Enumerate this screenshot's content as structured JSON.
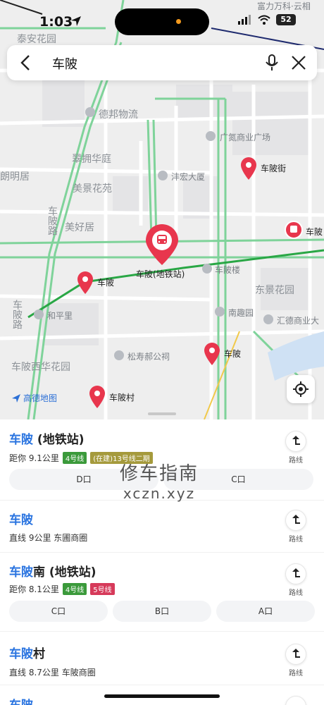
{
  "status": {
    "time": "1:03",
    "battery": "52"
  },
  "search": {
    "query": "车陂"
  },
  "map": {
    "labels": [
      "富力万科·云相",
      "泰安花园",
      "德邦物流",
      "广氮商业广场",
      "翠拥华庭",
      "沣宏大厦",
      "朗明居",
      "美景花苑",
      "车陂路",
      "美好居",
      "车陂楼",
      "东景花园",
      "和平里",
      "南趣园",
      "汇德商业大",
      "松寿郝公祠",
      "车陂路",
      "车陂西华花园"
    ],
    "pins": {
      "street": "车陂街",
      "metro_right": "车陂",
      "metro_main": "车陂(地铁站)",
      "p1": "车陂",
      "p2": "车陂",
      "village": "车陂村"
    },
    "logo": "高德地图"
  },
  "results": [
    {
      "hl": "车陂",
      "rest": " (地铁站)",
      "meta": "距你 9.1公里",
      "tags": [
        {
          "text": "4号线",
          "color": "green"
        },
        {
          "text": "(在建)13号线二期",
          "color": "olive"
        }
      ],
      "exits": [
        "D口",
        "C口"
      ],
      "route": "路线"
    },
    {
      "hl": "车陂",
      "rest": "",
      "meta": "直线 9公里  东圃商圈",
      "tags": [],
      "exits": [],
      "route": "路线"
    },
    {
      "hl": "车陂",
      "rest": "南 (地铁站)",
      "meta": "距你 8.1公里",
      "tags": [
        {
          "text": "4号线",
          "color": "green"
        },
        {
          "text": "5号线",
          "color": "red"
        }
      ],
      "exits": [
        "C口",
        "B口",
        "A口"
      ],
      "route": "路线"
    },
    {
      "hl": "车陂",
      "rest": "村",
      "meta": "直线 8.7公里  车陂商圈",
      "tags": [],
      "exits": [],
      "route": "路线"
    },
    {
      "hl": "车陂",
      "rest": "",
      "meta": "",
      "tags": [],
      "exits": [],
      "route": "路线"
    }
  ],
  "watermark": {
    "line1": "修车指南",
    "line2": "xczn.xyz"
  }
}
